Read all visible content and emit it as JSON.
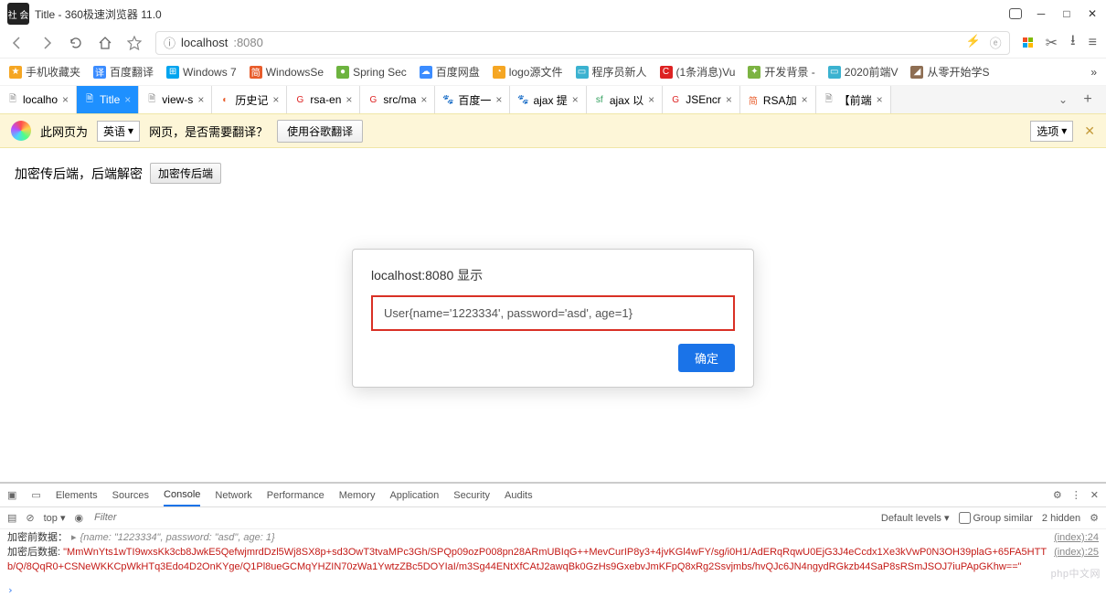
{
  "titlebar": {
    "avatar_text": "社 会",
    "title": "Title - 360极速浏览器 11.0"
  },
  "nav": {
    "host": "localhost",
    "port": ":8080"
  },
  "bookmarks": [
    {
      "label": "手机收藏夹",
      "color": "#f5a623"
    },
    {
      "label": "百度翻译",
      "color": "#3b8cff",
      "glyph": "译"
    },
    {
      "label": "Windows 7",
      "color": "#00a4ef"
    },
    {
      "label": "WindowsSe",
      "color": "#e85d2c",
      "glyph": "简"
    },
    {
      "label": "Spring Sec",
      "color": "#6db33f"
    },
    {
      "label": "百度网盘",
      "color": "#3b8cff"
    },
    {
      "label": "logo源文件",
      "color": "#f5a623"
    },
    {
      "label": "程序员新人",
      "color": "#3bb2d0"
    },
    {
      "label": "(1条消息)Vu",
      "color": "#d22",
      "glyph": "C"
    },
    {
      "label": "开发背景 -",
      "color": "#7cb342"
    },
    {
      "label": "2020前端V",
      "color": "#3bb2d0"
    },
    {
      "label": "从零开始学S",
      "color": "#8e6e53"
    }
  ],
  "tabs": [
    {
      "label": "localho",
      "icon": "doc",
      "color": "#888"
    },
    {
      "label": "Title",
      "icon": "doc",
      "color": "#fff",
      "active": true
    },
    {
      "label": "view-s",
      "icon": "doc",
      "color": "#888"
    },
    {
      "label": "历史记",
      "icon": "360",
      "color": "#e85d2c"
    },
    {
      "label": "rsa-en",
      "icon": "G",
      "color": "#d22"
    },
    {
      "label": "src/ma",
      "icon": "G",
      "color": "#d22"
    },
    {
      "label": "百度一",
      "icon": "paw",
      "color": "#3b8cff"
    },
    {
      "label": "ajax 提",
      "icon": "paw",
      "color": "#3b8cff"
    },
    {
      "label": "ajax 以",
      "icon": "sf",
      "color": "#2e9e5b"
    },
    {
      "label": "JSEncr",
      "icon": "G",
      "color": "#d22"
    },
    {
      "label": "RSA加",
      "icon": "简",
      "color": "#e85d2c"
    },
    {
      "label": "【前端",
      "icon": "doc",
      "color": "#888"
    }
  ],
  "translate": {
    "prefix": "此网页为",
    "lang": "英语",
    "suffix": "网页，是否需要翻译？",
    "translate_btn": "使用谷歌翻译",
    "options": "选项"
  },
  "page_content": {
    "heading": "加密传后端，后端解密",
    "button": "加密传后端"
  },
  "dialog": {
    "title": "localhost:8080 显示",
    "body": "User{name='1223334', password='asd', age=1}",
    "ok": "确定"
  },
  "devtools": {
    "tabs": [
      "Elements",
      "Sources",
      "Console",
      "Network",
      "Performance",
      "Memory",
      "Application",
      "Security",
      "Audits"
    ],
    "active_tab": "Console",
    "context": "top",
    "filter_placeholder": "Filter",
    "levels": "Default levels",
    "group_similar": "Group similar",
    "hidden": "2 hidden",
    "log1_label": "加密前数据：",
    "log1_value": "{name: \"1223334\", password: \"asd\", age: 1}",
    "log1_src": "(index):24",
    "log2_label": "加密后数据:",
    "log2_value": "\"MmWnYts1wTI9wxsKk3cb8JwkE5QefwjmrdDzl5Wj8SX8p+sd3OwT3tvaMPc3Gh/SPQp09ozP008pn28ARmUBIqG++MevCurIP8y3+4jvKGl4wFY/sg/i0H1/AdERqRqwU0EjG3J4eCcdx1Xe3kVwP0N3OH39plaG+65FA5HTTb/Q/8QqR0+CSNeWKKCpWkHTq3Edo4D2OnKYge/Q1Pl8ueGCMqYHZIN70zWa1YwtzZBc5DOYIaI/m3Sg44ENtXfCAtJ2awqBk0GzHs9GxebvJmKFpQ8xRg2Ssvjmbs/hvQJc6JN4ngydRGkzb44SaP8sRSmJSOJ7iuPApGKhw==\"",
    "log2_src": "(index):25",
    "watermark": "php中文网"
  }
}
